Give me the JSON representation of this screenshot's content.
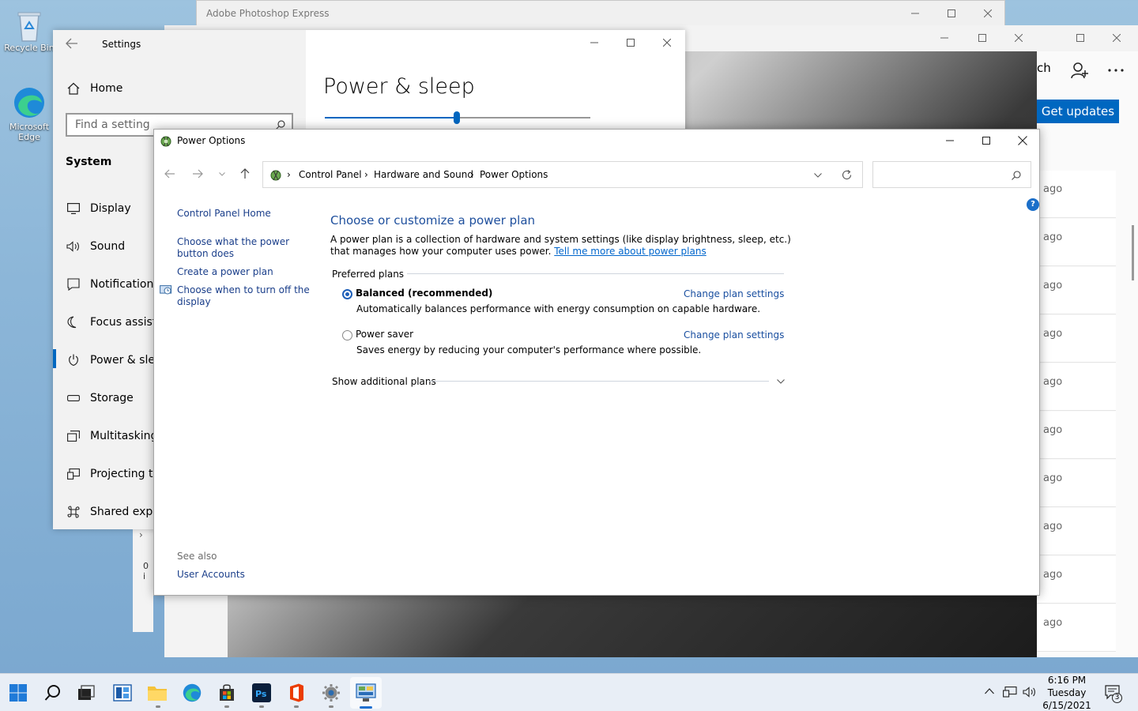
{
  "desktop": {
    "icons": [
      {
        "label": "Recycle Bin"
      },
      {
        "label": "Microsoft Edge"
      }
    ]
  },
  "photoshop_window": {
    "title": "Adobe Photoshop Express"
  },
  "right_window": {
    "partial_label": "ch",
    "get_updates_label": "Get updates",
    "ago_items": [
      "ago",
      "ago",
      "ago",
      "ago",
      "ago",
      "ago",
      "ago",
      "ago",
      "ago",
      "ago"
    ],
    "partial_texts": [
      "0 i"
    ]
  },
  "settings": {
    "title": "Settings",
    "home_label": "Home",
    "search_placeholder": "Find a setting",
    "section_label": "System",
    "nav_items": [
      {
        "label": "Display"
      },
      {
        "label": "Sound"
      },
      {
        "label": "Notifications"
      },
      {
        "label": "Focus assist"
      },
      {
        "label": "Power & slee"
      },
      {
        "label": "Storage"
      },
      {
        "label": "Multitasking"
      },
      {
        "label": "Projecting to"
      },
      {
        "label": "Shared exper"
      }
    ],
    "page_title": "Power & sleep"
  },
  "power_options": {
    "window_title": "Power Options",
    "breadcrumb": [
      "Control Panel",
      "Hardware and Sound",
      "Power Options"
    ],
    "search_placeholder": "",
    "sidebar": {
      "home": "Control Panel Home",
      "links": [
        "Choose what the power button does",
        "Create a power plan",
        "Choose when to turn off the display"
      ],
      "see_also_label": "See also",
      "see_also_links": [
        "User Accounts"
      ]
    },
    "heading": "Choose or customize a power plan",
    "description": "A power plan is a collection of hardware and system settings (like display brightness, sleep, etc.) that manages how your computer uses power. ",
    "learn_more_link": "Tell me more about power plans",
    "preferred_plans_label": "Preferred plans",
    "plans": [
      {
        "name": "Balanced (recommended)",
        "description": "Automatically balances performance with energy consumption on capable hardware.",
        "change_label": "Change plan settings",
        "selected": true
      },
      {
        "name": "Power saver",
        "description": "Saves energy by reducing your computer's performance where possible.",
        "change_label": "Change plan settings",
        "selected": false
      }
    ],
    "show_additional_label": "Show additional plans"
  },
  "taskbar": {
    "clock": {
      "time": "6:16 PM",
      "day": "Tuesday",
      "date": "6/15/2021"
    },
    "notification_count": "3"
  },
  "colors": {
    "accent": "#0067c0",
    "link": "#1a4fa0",
    "heading": "#1e4f9d"
  }
}
